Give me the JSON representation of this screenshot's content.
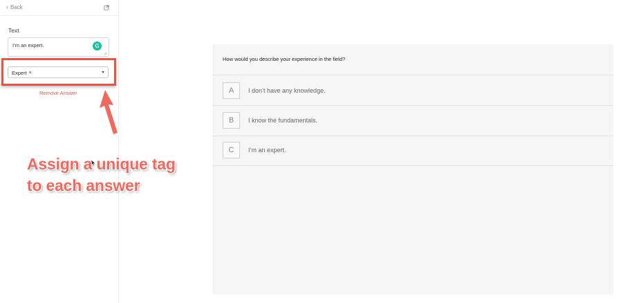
{
  "sidebar": {
    "back_label": "Back",
    "text_field_label": "Text",
    "text_value": "I’m an expert.",
    "grammarly_letter": "G",
    "tag_value": "Expert",
    "tag_remove": "×",
    "remove_answer_label": "Remove Answer"
  },
  "annotation": {
    "line1": "Assign a unique tag",
    "line2": "to each answer",
    "color": "#f0695e"
  },
  "preview": {
    "question": "How would you describe your experience in the field?",
    "options": [
      {
        "key": "A",
        "text": "I don’t have any knowledge."
      },
      {
        "key": "B",
        "text": "I know the fundamentals."
      },
      {
        "key": "C",
        "text": "I’m an expert."
      }
    ]
  },
  "colors": {
    "highlight": "#e8534a",
    "remove_link": "#e4574d",
    "grammarly": "#15c39a",
    "preview_bg": "#f6f6f6"
  },
  "icons": [
    "chevron-left-icon",
    "external-link-icon",
    "grammarly-icon",
    "close-icon",
    "caret-down-icon",
    "arrow-icon",
    "mouse-cursor-icon"
  ]
}
